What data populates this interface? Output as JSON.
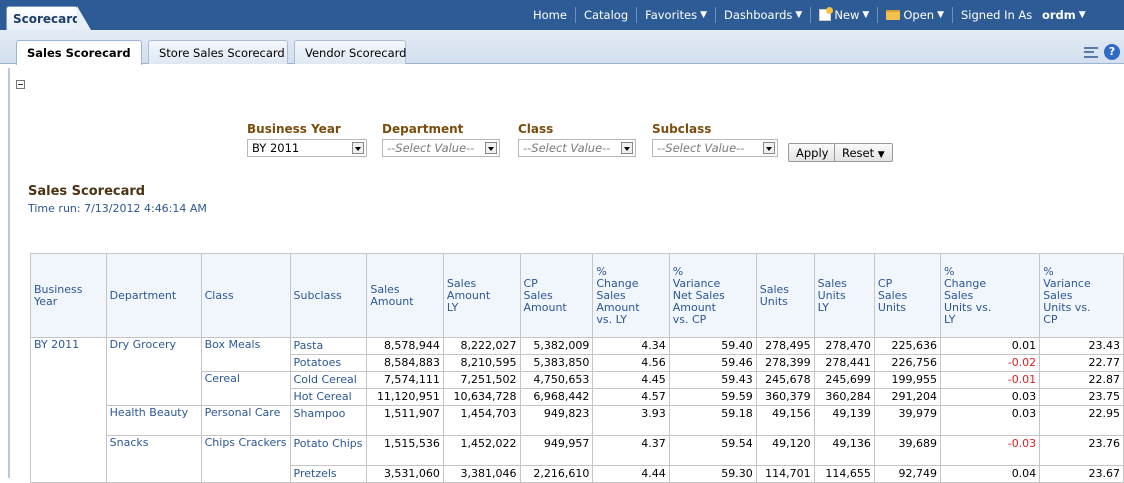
{
  "header": {
    "app_tab": "Scorecard",
    "nav": [
      "Home",
      "Catalog"
    ],
    "favorites": "Favorites",
    "dashboards": "Dashboards",
    "new": "New",
    "open": "Open",
    "signed_in_label": "Signed In As",
    "user": "ordm"
  },
  "tabs": [
    "Sales Scorecard",
    "Store Sales Scorecard",
    "Vendor Scorecard"
  ],
  "prompts": {
    "business_year": {
      "label": "Business Year",
      "value": "BY 2011"
    },
    "department": {
      "label": "Department",
      "placeholder": "--Select Value--"
    },
    "class": {
      "label": "Class",
      "placeholder": "--Select Value--"
    },
    "subclass": {
      "label": "Subclass",
      "placeholder": "--Select Value--"
    },
    "apply": "Apply",
    "reset": "Reset"
  },
  "report": {
    "title": "Sales Scorecard",
    "time_run": "Time run: 7/13/2012 4:46:14 AM"
  },
  "table": {
    "headers": [
      "Business\nYear",
      "Department",
      "Class",
      "Subclass",
      "Sales\nAmount",
      "Sales\nAmount\nLY",
      "CP\nSales\nAmount",
      "%\nChange\nSales\nAmount\nvs. LY",
      "%\nVariance\nNet Sales\nAmount\nvs. CP",
      "Sales\nUnits",
      "Sales\nUnits\nLY",
      "CP\nSales\nUnits",
      "%\nChange\nSales\nUnits vs.\nLY",
      "%\nVariance\nSales\nUnits vs.\nCP"
    ],
    "rows": [
      {
        "year": "BY 2011",
        "dept": "Dry Grocery",
        "cls": "Box Meals",
        "sub": "Pasta",
        "v": [
          "8,578,944",
          "8,222,027",
          "5,382,009",
          "4.34",
          "59.40",
          "278,495",
          "278,470",
          "225,636",
          "0.01",
          "23.43"
        ]
      },
      {
        "year": "",
        "dept": "",
        "cls": "",
        "sub": "Potatoes",
        "v": [
          "8,584,883",
          "8,210,595",
          "5,383,850",
          "4.56",
          "59.46",
          "278,399",
          "278,441",
          "226,756",
          "-0.02",
          "22.77"
        ]
      },
      {
        "year": "",
        "dept": "",
        "cls": "Cereal",
        "sub": "Cold Cereal",
        "v": [
          "7,574,111",
          "7,251,502",
          "4,750,653",
          "4.45",
          "59.43",
          "245,678",
          "245,699",
          "199,955",
          "-0.01",
          "22.87"
        ]
      },
      {
        "year": "",
        "dept": "",
        "cls": "",
        "sub": "Hot Cereal",
        "v": [
          "11,120,951",
          "10,634,728",
          "6,968,442",
          "4.57",
          "59.59",
          "360,379",
          "360,284",
          "291,204",
          "0.03",
          "23.75"
        ]
      },
      {
        "year": "",
        "dept": "Health Beauty",
        "cls": "Personal Care",
        "sub": "Shampoo",
        "v": [
          "1,511,907",
          "1,454,703",
          "949,823",
          "3.93",
          "59.18",
          "49,156",
          "49,139",
          "39,979",
          "0.03",
          "22.95"
        ]
      },
      {
        "year": "",
        "dept": "Snacks",
        "cls": "Chips Crackers",
        "sub": "Potato Chips",
        "v": [
          "1,515,536",
          "1,452,022",
          "949,957",
          "4.37",
          "59.54",
          "49,120",
          "49,136",
          "39,689",
          "-0.03",
          "23.76"
        ]
      },
      {
        "year": "",
        "dept": "",
        "cls": "",
        "sub": "Pretzels",
        "v": [
          "3,531,060",
          "3,381,046",
          "2,216,610",
          "4.44",
          "59.30",
          "114,701",
          "114,655",
          "92,749",
          "0.04",
          "23.67"
        ]
      }
    ]
  },
  "colors": {
    "header_bar": "#2d5b95",
    "link": "#2c5796",
    "negative": "#e02020",
    "prompt_label": "#7a4d0f"
  }
}
